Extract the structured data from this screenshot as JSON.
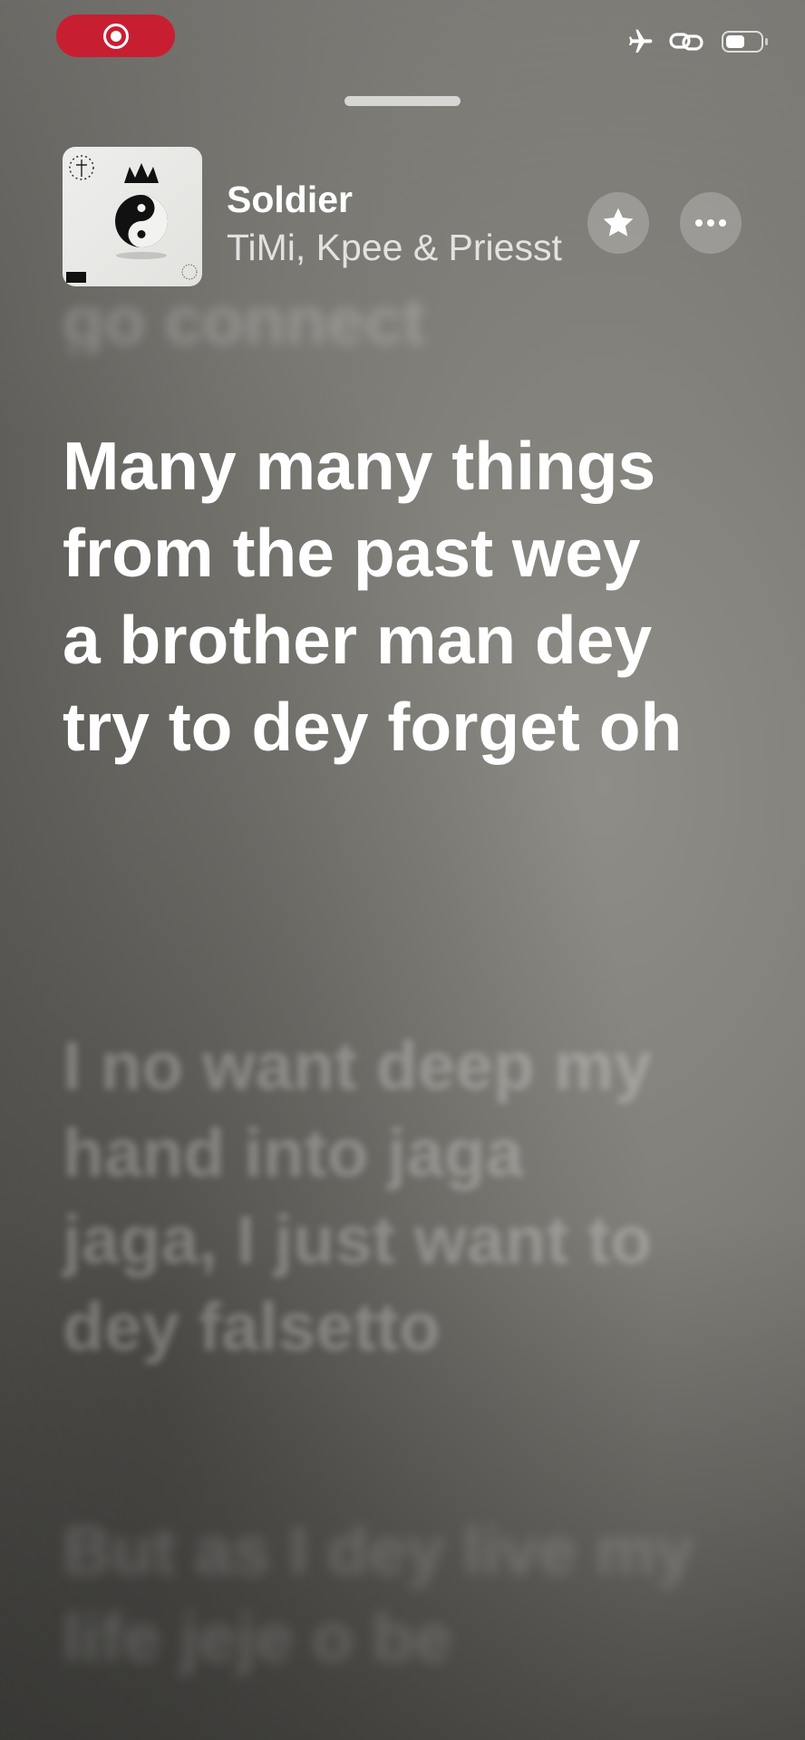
{
  "status_bar": {
    "recording_indicator": "record-icon",
    "icons": [
      "airplane-icon",
      "link-icon",
      "battery-icon"
    ],
    "accent_color": "#c81e32"
  },
  "now_playing": {
    "title": "Soldier",
    "artist": "TiMi, Kpee & Priesst",
    "art_label": "album-art",
    "favorite_icon": "star-icon",
    "more_icon": "ellipsis-icon"
  },
  "lyrics": {
    "previous": "go connect",
    "current": "Many many things from the past wey a brother man dey try to dey forget oh",
    "next": "I no want deep my hand into jaga jaga, I just want to dey falsetto",
    "after": "But as I dey live my life jeje o be"
  }
}
